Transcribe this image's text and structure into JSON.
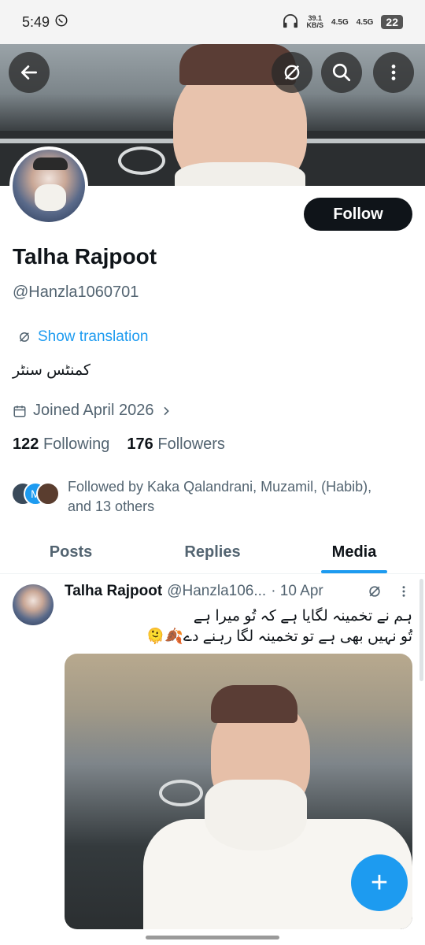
{
  "status_bar": {
    "time": "5:49",
    "net_speed_value": "39.1",
    "net_speed_unit": "KB/S",
    "signal_1": "4.5G",
    "signal_2": "4.5G",
    "battery": "22"
  },
  "header": {
    "back_icon": "arrow-left-icon",
    "translate_icon": "translate-icon",
    "search_icon": "search-icon",
    "more_icon": "more-vertical-icon"
  },
  "profile": {
    "follow_label": "Follow",
    "name": "Talha Rajpoot",
    "handle": "@Hanzla1060701",
    "show_translation": "Show translation",
    "bio": "کمنٹس سنٹر",
    "joined": "Joined April 2026",
    "following_count": "122",
    "following_label": "Following",
    "followers_count": "176",
    "followers_label": "Followers",
    "followed_by_line1": "Followed by Kaka Qalandrani, Muzamil, (Habib),",
    "followed_by_line2": "and 13 others",
    "mini_avatar_letter": "M"
  },
  "tabs": [
    {
      "label": "Posts",
      "active": false
    },
    {
      "label": "Replies",
      "active": false
    },
    {
      "label": "Media",
      "active": true
    }
  ],
  "post": {
    "author": "Talha Rajpoot",
    "handle": "@Hanzla106...",
    "date": "· 10 Apr",
    "line1": "ہم نے تخمینہ لگایا ہے کہ تُو میرا ہے",
    "line2": "تُو نہیں بھی ہے تو تخمینہ لگا رہنے دے🍂🫠"
  },
  "fab": {
    "label": "+"
  },
  "colors": {
    "accent": "#1d9bf0",
    "text": "#0f1419",
    "muted": "#536471"
  }
}
